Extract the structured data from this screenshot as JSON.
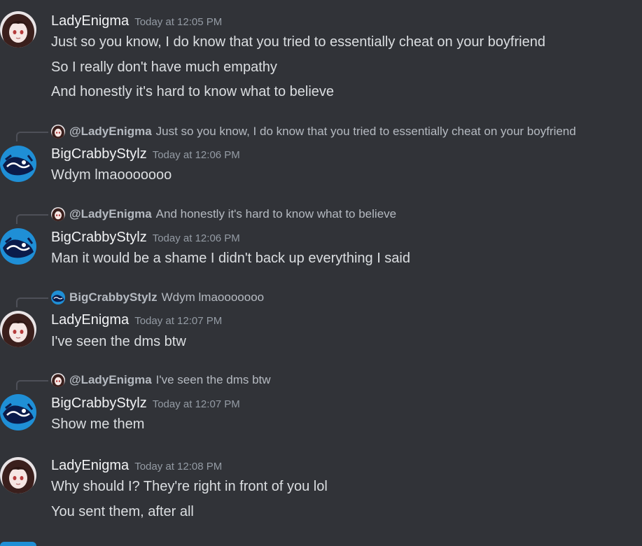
{
  "messages": [
    {
      "username": "LadyEnigma",
      "timestamp": "Today at 12:05 PM",
      "lines": [
        "Just so you know, I do know that you tried to essentially cheat on your boyfriend",
        "So I really don't have much empathy",
        "And honestly it's hard to know what to believe"
      ]
    },
    {
      "reply": {
        "name": "@LadyEnigma",
        "text": "Just so you know, I do know that you tried to essentially cheat on your boyfriend"
      },
      "username": "BigCrabbyStylz",
      "timestamp": "Today at 12:06 PM",
      "lines": [
        "Wdym lmaooooooo"
      ]
    },
    {
      "reply": {
        "name": "@LadyEnigma",
        "text": "And honestly it's hard to know what to believe"
      },
      "username": "BigCrabbyStylz",
      "timestamp": "Today at 12:06 PM",
      "lines": [
        "Man it would be a shame I didn't back up everything I said"
      ]
    },
    {
      "reply": {
        "name": "BigCrabbyStylz",
        "text": "Wdym lmaooooooo"
      },
      "username": "LadyEnigma",
      "timestamp": "Today at 12:07 PM",
      "lines": [
        "I've seen the dms btw"
      ]
    },
    {
      "reply": {
        "name": "@LadyEnigma",
        "text": "I've seen the dms btw"
      },
      "username": "BigCrabbyStylz",
      "timestamp": "Today at 12:07 PM",
      "lines": [
        "Show me them"
      ]
    },
    {
      "username": "LadyEnigma",
      "timestamp": "Today at 12:08 PM",
      "lines": [
        "Why should I? They're right in front of you lol",
        "You sent them, after all"
      ]
    }
  ],
  "colors": {
    "background": "#313338",
    "username": "#f2f3f5",
    "timestamp": "#949ba4",
    "message_text": "#dbdee1",
    "reply_text": "#b5bac1",
    "reply_spine": "#4e5058"
  },
  "icons": {
    "lady_avatar": "anime-girl-avatar-icon",
    "crabby_avatar": "blue-crab-avatar-icon"
  }
}
